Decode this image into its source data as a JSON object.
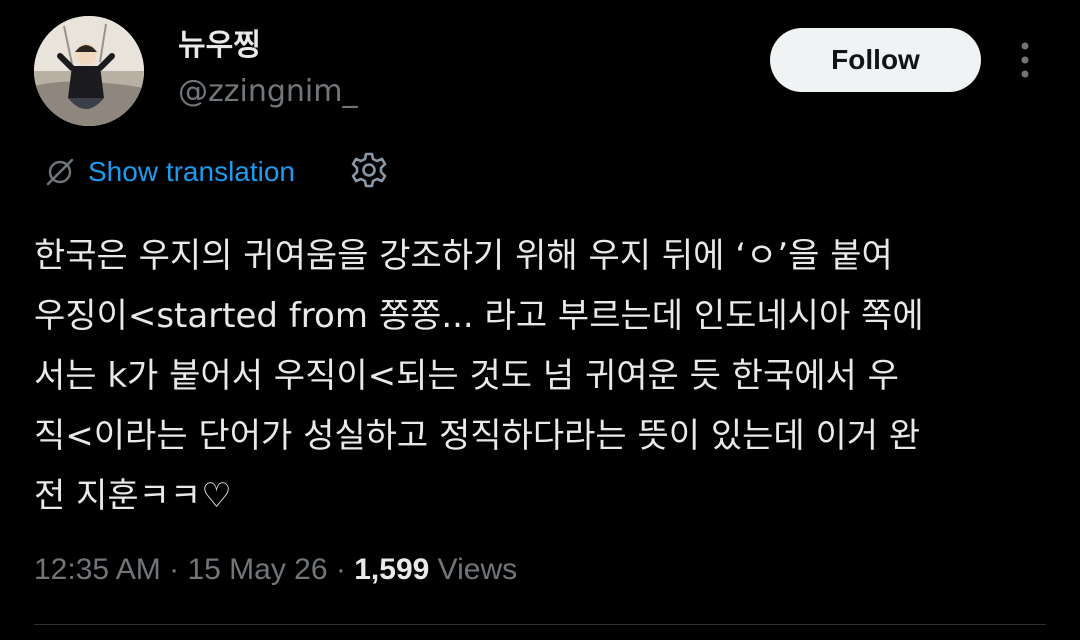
{
  "author": {
    "display_name": "뉴우찡",
    "handle": "@zzingnim_"
  },
  "actions": {
    "follow_label": "Follow",
    "more_icon": "more-vertical-icon"
  },
  "translation": {
    "label": "Show translation",
    "icon": "globe-off-icon",
    "settings_icon": "gear-icon"
  },
  "tweet": {
    "lines": [
      "한국은 우지의 귀여움을 강조하기 위해 우지 뒤에 ‘ㅇ’을 붙여",
      "우징이<started from 쫑쫑... 라고 부르는데 인도네시아 쪽에",
      "서는 k가 붙어서 우직이<되는 것도 넘 귀여운 듯 한국에서 우",
      "직<이라는 단어가 성실하고 정직하다라는 뜻이 있는데 이거 완",
      "전 지훈ㅋㅋ♡"
    ]
  },
  "meta": {
    "time": "12:35 AM",
    "separator": "·",
    "date": "15 May 26",
    "views_count": "1,599",
    "views_label": "Views"
  },
  "colors": {
    "background": "#000000",
    "text_primary": "#e7e9ea",
    "text_secondary": "#71767b",
    "link": "#1d9bf0",
    "follow_bg": "#eff3f4"
  }
}
